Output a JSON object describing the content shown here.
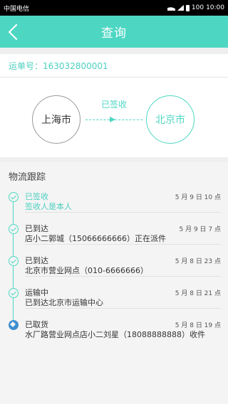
{
  "statusbar": {
    "carrier": "中国电信",
    "battery": "100",
    "time": "10:00"
  },
  "navbar": {
    "title": "查询"
  },
  "waybill": {
    "label": "运单号：163032800001"
  },
  "route": {
    "from": "上海市",
    "to": "北京市",
    "status": "已签收"
  },
  "tracking": {
    "title": "物流跟踪",
    "items": [
      {
        "status": "已签收",
        "detail": "签收人是本人",
        "time": "5 月 9 日 10 点",
        "icon": "check-icon"
      },
      {
        "status": "已到达",
        "detail": "店小二郭城（15066666666）正在派件",
        "time": "5 月 9 日 7 点",
        "icon": "check-icon"
      },
      {
        "status": "已到达",
        "detail": "北京市营业网点（010-6666666）",
        "time": "5 月 8 日 23 点",
        "icon": "check-icon"
      },
      {
        "status": "运输中",
        "detail": "已到达北京市运输中心",
        "time": "5 月 8 日 21 点",
        "icon": "check-icon"
      },
      {
        "status": "已取货",
        "detail": "水厂路营业网点店小二刘星（18088888888）收件",
        "time": "5 月 8 日 19 点",
        "icon": "courier-icon"
      }
    ]
  },
  "colors": {
    "accent": "#4dd7c3",
    "statusbar": "#000000"
  }
}
